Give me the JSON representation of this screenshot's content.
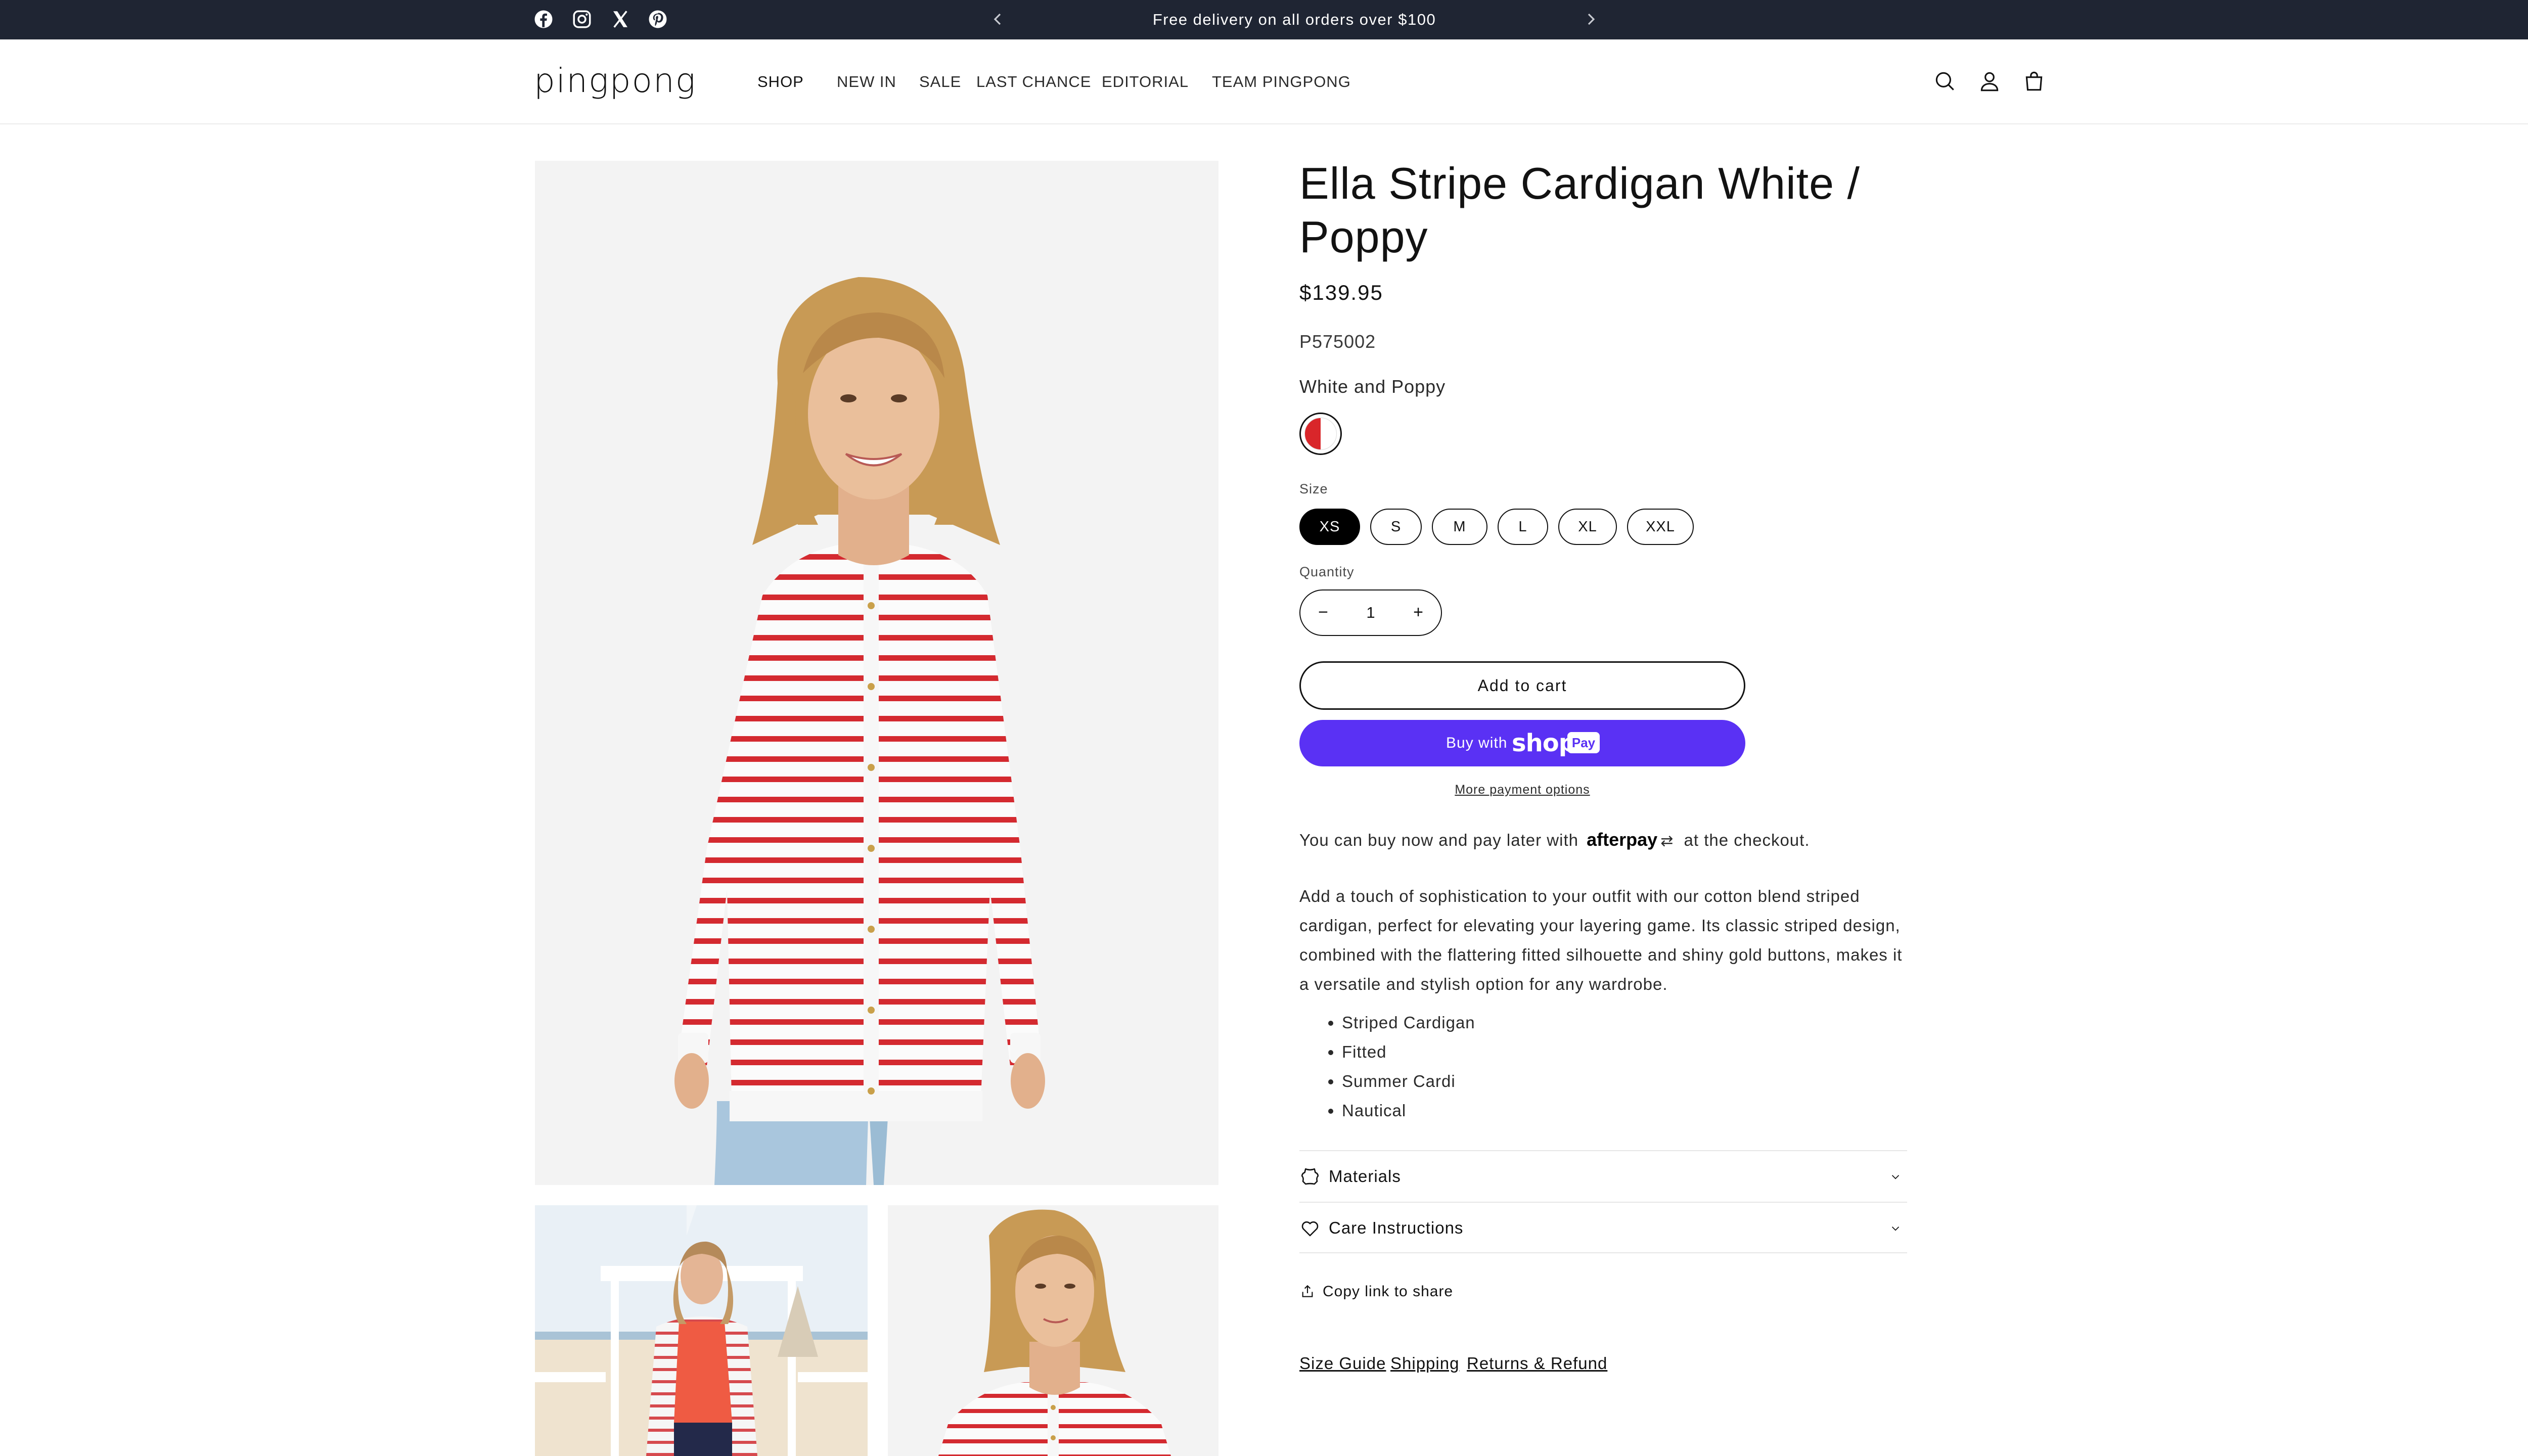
{
  "announcement": {
    "text": "Free delivery on all orders over $100",
    "social": [
      "facebook-icon",
      "instagram-icon",
      "x-icon",
      "pinterest-icon"
    ],
    "background": "#1f2533"
  },
  "header": {
    "logo": "pingpong",
    "nav": [
      "SHOP",
      "NEW IN",
      "SALE",
      "LAST CHANCE",
      "EDITORIAL",
      "TEAM PINGPONG"
    ],
    "icons": [
      "search-icon",
      "account-icon",
      "cart-icon"
    ]
  },
  "product": {
    "title": "Ella Stripe Cardigan White / Poppy",
    "price": "$139.95",
    "sku": "P575002",
    "color_name": "White and Poppy",
    "swatch_colors": [
      "#d9262a",
      "#ffffff"
    ],
    "size_label": "Size",
    "sizes": [
      "XS",
      "S",
      "M",
      "L",
      "XL",
      "XXL"
    ],
    "selected_size": "XS",
    "quantity_label": "Quantity",
    "quantity": "1",
    "add_to_cart": "Add to cart",
    "buy_with": "Buy with",
    "shop_pay_brand": "shop",
    "shop_pay_badge": "Pay",
    "shop_pay_color": "#5a31f4",
    "more_payment": "More payment options",
    "afterpay_prefix": "You can buy now and pay later with",
    "afterpay_brand": "afterpay",
    "afterpay_suffix": "at the checkout.",
    "description": "Add a touch of sophistication to your outfit with our cotton blend striped cardigan, perfect for elevating your layering game. Its classic striped design, combined with the flattering fitted silhouette and shiny gold buttons, makes it a versatile and stylish option for any wardrobe.",
    "features": [
      "Striped Cardigan",
      "Fitted",
      "Summer Cardi",
      "Nautical"
    ],
    "accordions": [
      {
        "label": "Materials",
        "icon": "leather-icon"
      },
      {
        "label": "Care Instructions",
        "icon": "heart-icon"
      }
    ],
    "share": "Copy link to share",
    "links": [
      "Size Guide",
      "Shipping",
      "Returns & Refund"
    ]
  }
}
